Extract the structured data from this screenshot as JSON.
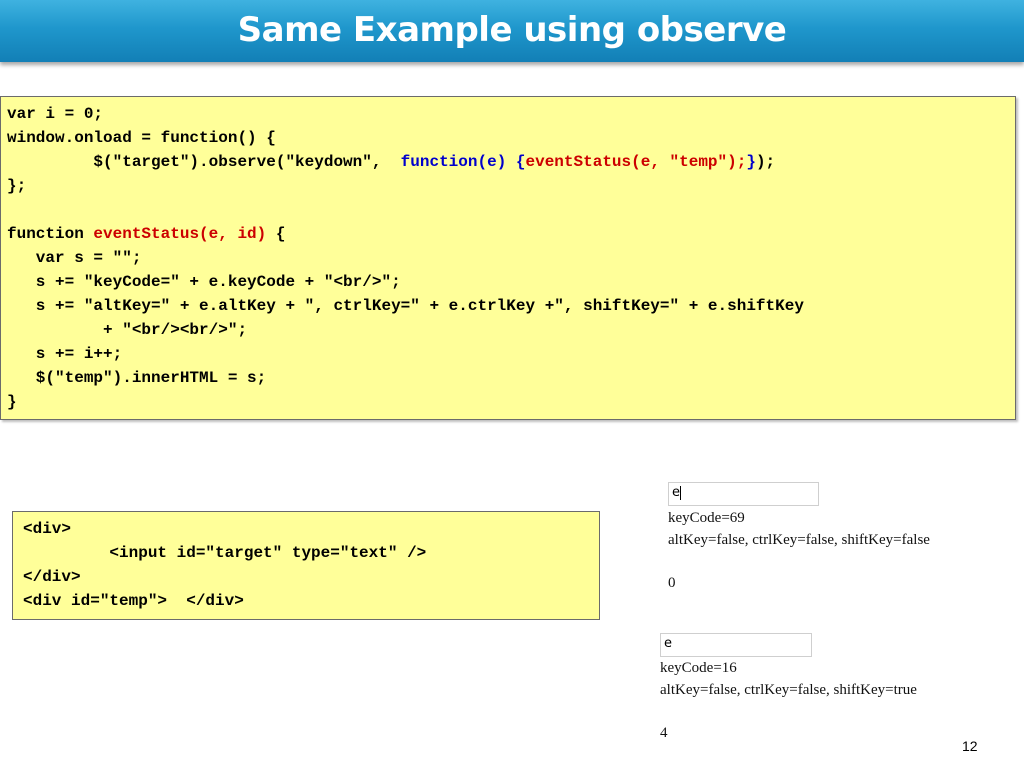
{
  "slide": {
    "title": "Same Example using observe",
    "number": "12",
    "title_bar_color": "#1f97cc"
  },
  "code_main": {
    "background": "#ffff99",
    "l1": "var i = 0;",
    "l2": "window.onload = function() {",
    "l3a": "         $(\"target\").observe(\"keydown\",  ",
    "l3b": "function(e)",
    "l3c": " {",
    "l3d": "eventStatus(e, \"temp\");",
    "l3e": "}",
    "l3f": ");",
    "l4": "};",
    "l6a": "function ",
    "l6b": "eventStatus(e, id)",
    "l6c": " {",
    "l7": "   var s = \"\";",
    "l8": "   s += \"keyCode=\" + e.keyCode + \"<br/>\";",
    "l9": "   s += \"altKey=\" + e.altKey + \", ctrlKey=\" + e.ctrlKey +\", shiftKey=\" + e.shiftKey",
    "l10": "          + \"<br/><br/>\";",
    "l11": "   s += i++;",
    "l12": "   $(\"temp\").innerHTML = s;",
    "l13": "}"
  },
  "code_html": {
    "l1": "<div>",
    "l2": "         <input id=\"target\" type=\"text\" />",
    "l3": "</div>",
    "l4": "<div id=\"temp\">  </div>"
  },
  "demo1": {
    "input_value": "e",
    "keycode_line": "keyCode=69",
    "keys_line": "altKey=false, ctrlKey=false, shiftKey=false",
    "counter": "0"
  },
  "demo2": {
    "input_value": "e",
    "keycode_line": "keyCode=16",
    "keys_line": "altKey=false, ctrlKey=false, shiftKey=true",
    "counter": "4"
  }
}
